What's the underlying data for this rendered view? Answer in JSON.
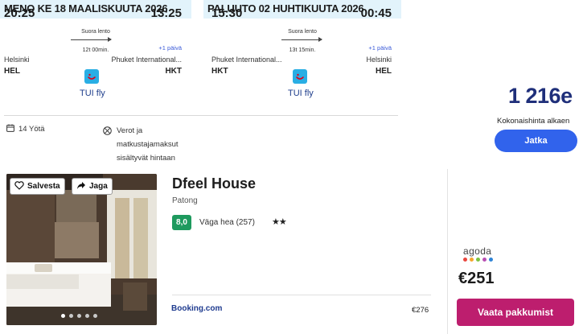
{
  "outbound": {
    "header": "MENO KE 18 MAALISKUUTA 2026",
    "dep_time": "20:25",
    "arr_time": "13:25",
    "route_type": "Suora lento",
    "duration": "12t 00min.",
    "plus_day": "+1 päivä",
    "dep_city": "Helsinki",
    "arr_city": "Phuket International...",
    "dep_code": "HEL",
    "arr_code": "HKT",
    "airline": "TUI fly"
  },
  "return": {
    "header": "PALUUTO 02 HUHTIKUUTA 2026",
    "dep_time": "15:30",
    "arr_time": "00:45",
    "route_type": "Suora lento",
    "duration": "13t 15min.",
    "plus_day": "+1 päivä",
    "dep_city": "Phuket International...",
    "arr_city": "Helsinki",
    "dep_code": "HKT",
    "arr_code": "HEL",
    "airline": "TUI fly"
  },
  "package": {
    "total_price": "1 216e",
    "price_label": "Kokonaishinta alkaen",
    "continue_label": "Jatka",
    "nights": "14 Yötä",
    "taxes_lines": [
      "Verot ja",
      "matkustajamaksut",
      "sisältyvät hintaan"
    ]
  },
  "hotel": {
    "save_label": "Salvesta",
    "share_label": "Jaga",
    "name": "Dfeel House",
    "area": "Patong",
    "score": "8,0",
    "rating_text": "Väga hea (257)",
    "stars": "★★",
    "stars_count": 2,
    "photo_count": 5,
    "photo_active_index": 0,
    "provider": "Booking.com",
    "provider_price": "€276",
    "deal_provider": "agoda",
    "deal_price": "€251",
    "view_label": "Vaata pakkumist"
  },
  "colors": {
    "header_bg": "#e2f3fb",
    "primary_button": "#3163ec",
    "price_text": "#1f2f7a",
    "score_badge": "#1e9a5e",
    "view_button": "#bd1e6e",
    "airline_logo": "#29aee4",
    "agoda_dots": [
      "#e9463e",
      "#f6a52b",
      "#7cc242",
      "#b84fb3",
      "#2e83d6"
    ]
  },
  "icons": {
    "nights": "calendar-icon",
    "taxes": "no-extra-fees-icon",
    "save": "heart-icon",
    "share": "share-arrow-icon",
    "airline": "tui-smile-icon"
  }
}
